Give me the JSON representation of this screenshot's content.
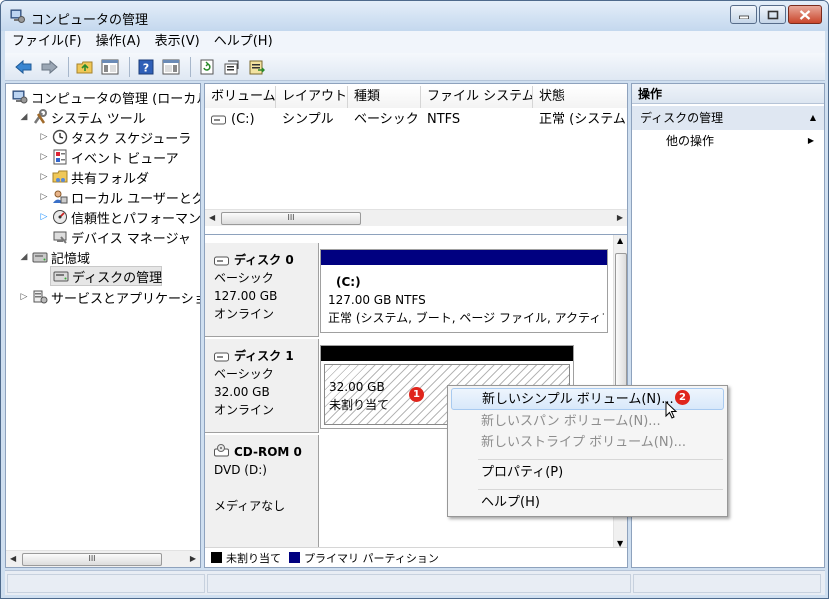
{
  "window": {
    "title": "コンピュータの管理"
  },
  "menu": [
    "ファイル(F)",
    "操作(A)",
    "表示(V)",
    "ヘルプ(H)"
  ],
  "toolbar": {
    "icons": [
      "back-icon",
      "forward-icon",
      "up-folder-icon",
      "show-hide-tree-icon",
      "help-icon",
      "show-hide-action-icon",
      "refresh-icon",
      "properties-icon",
      "export-icon"
    ]
  },
  "tree": {
    "root": "コンピュータの管理 (ローカル)",
    "system_tools": "システム ツール",
    "task_scheduler": "タスク スケジューラ",
    "event_viewer": "イベント ビューア",
    "shared_folders": "共有フォルダ",
    "local_users": "ローカル ユーザーとグループ",
    "reliability": "信頼性とパフォーマンス",
    "device_manager": "デバイス マネージャ",
    "storage": "記憶域",
    "disk_management": "ディスクの管理",
    "services_apps": "サービスとアプリケーション"
  },
  "volume_list": {
    "columns": [
      "ボリューム",
      "レイアウト",
      "種類",
      "ファイル システム",
      "状態"
    ],
    "rows": [
      {
        "volume": "(C:)",
        "layout": "シンプル",
        "type": "ベーシック",
        "fs": "NTFS",
        "status": "正常 (システム, ブート, ページ ファイル, アクティブ)"
      }
    ]
  },
  "scroll": {
    "thumb_glyph": "III"
  },
  "disks": [
    {
      "name": "ディスク 0",
      "type": "ベーシック",
      "size": "127.00 GB",
      "state": "オンライン",
      "volume": {
        "label": "(C:)",
        "size_fs": "127.00 GB NTFS",
        "status": "正常 (システム, ブート, ページ ファイル, アクティブ"
      }
    },
    {
      "name": "ディスク 1",
      "type": "ベーシック",
      "size": "32.00 GB",
      "state": "オンライン",
      "volume": {
        "size": "32.00 GB",
        "status": "未割り当て"
      }
    },
    {
      "name": "CD-ROM 0",
      "type": "DVD (D:)",
      "media": "メディアなし"
    }
  ],
  "legend": {
    "unallocated": "未割り当て",
    "primary": "プライマリ パーティション",
    "unallocated_color": "#000000",
    "primary_color": "#000080"
  },
  "actions": {
    "header": "操作",
    "section": "ディスクの管理",
    "more": "他の操作"
  },
  "context_menu": {
    "new_simple": "新しいシンプル ボリューム(N)...",
    "new_spanned": "新しいスパン ボリューム(N)...",
    "new_striped": "新しいストライプ ボリューム(N)...",
    "properties": "プロパティ(P)",
    "help": "ヘルプ(H)"
  },
  "annotations": {
    "one": "1",
    "two": "2"
  }
}
